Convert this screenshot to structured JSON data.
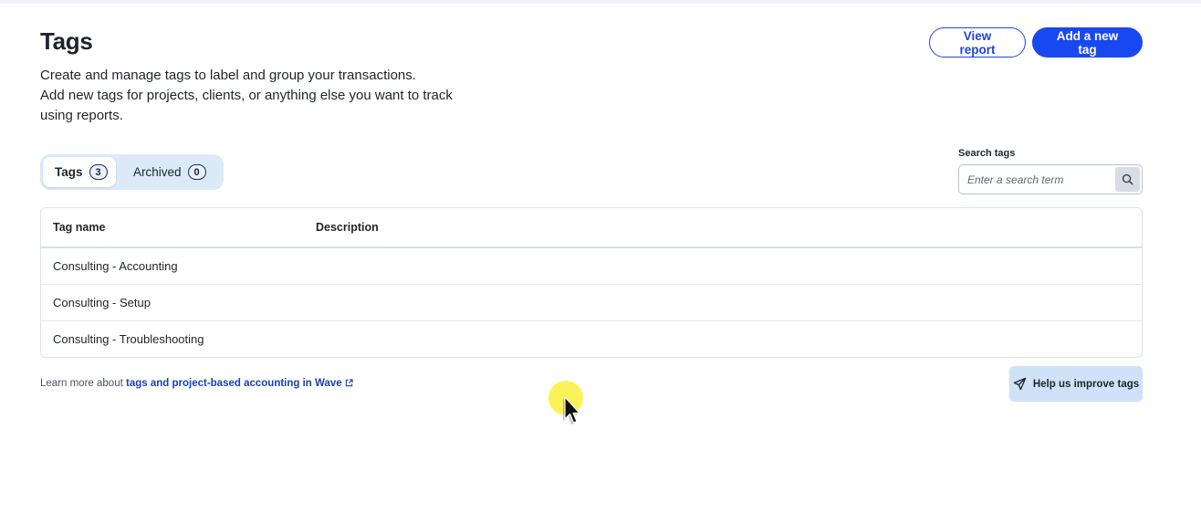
{
  "page": {
    "title": "Tags",
    "intro_lines": [
      "Create and manage tags to label and group your transactions.",
      "Add new tags for projects, clients, or anything else you want to track",
      "using reports."
    ]
  },
  "header_actions": {
    "view_report_label": "View report",
    "add_tag_label": "Add a new tag"
  },
  "tabs": [
    {
      "label": "Tags",
      "count": "3",
      "active": true
    },
    {
      "label": "Archived",
      "count": "0",
      "active": false
    }
  ],
  "search": {
    "label": "Search tags",
    "placeholder": "Enter a search term",
    "value": "",
    "icon": "search-icon"
  },
  "table": {
    "columns": [
      "Tag name",
      "Description"
    ],
    "rows": [
      {
        "name": "Consulting - Accounting",
        "description": ""
      },
      {
        "name": "Consulting - Setup",
        "description": ""
      },
      {
        "name": "Consulting - Troubleshooting",
        "description": ""
      }
    ]
  },
  "footer": {
    "learn_more_prefix": "Learn more about",
    "learn_more_link": "tags and project-based accounting in Wave",
    "feedback_label": "Help us improve tags"
  },
  "colors": {
    "primary": "#1848f0",
    "segmented_bg": "#dceaf8",
    "feedback_bg": "#cfe2f7",
    "cursor_highlight": "#faf03c"
  }
}
